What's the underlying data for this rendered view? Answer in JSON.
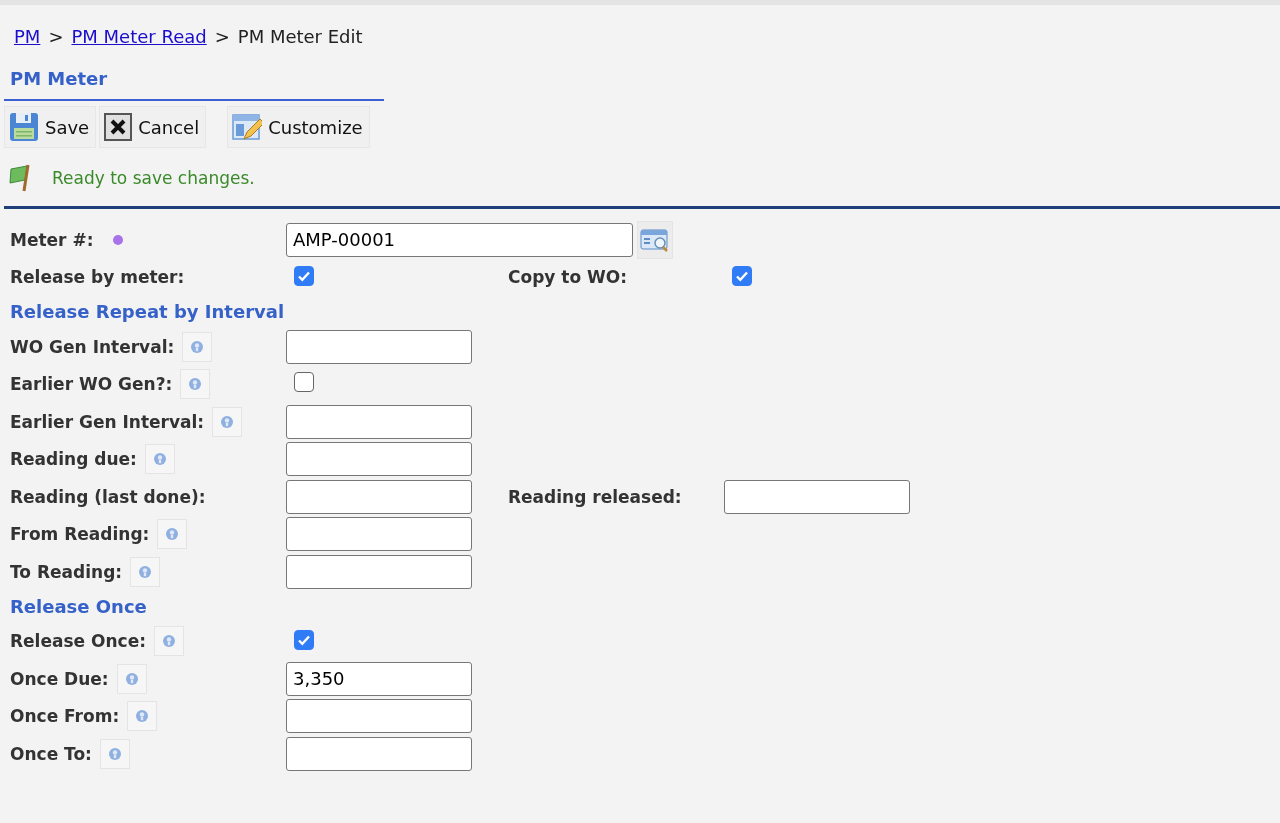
{
  "breadcrumb": [
    {
      "label": "PM",
      "link": true
    },
    {
      "label": "PM Meter Read",
      "link": true
    },
    {
      "label": "PM Meter Edit",
      "link": false
    }
  ],
  "breadcrumb_separator": ">",
  "title": "PM Meter",
  "toolbar": [
    {
      "label": "Save"
    },
    {
      "label": "Cancel"
    },
    {
      "label": "Customize"
    }
  ],
  "status_message": "Ready to save changes.",
  "form": [
    {
      "kind": "field",
      "label": "Meter #:",
      "required": true,
      "help": false,
      "control": {
        "kind": "text",
        "value": "AMP-00001",
        "wide": true,
        "lookup": true
      }
    },
    {
      "kind": "field",
      "label": "Release by meter:",
      "required": false,
      "help": false,
      "control": {
        "kind": "checkbox",
        "checked": true
      },
      "right": {
        "label": "Copy to WO:",
        "control": {
          "kind": "checkbox",
          "checked": true
        }
      }
    },
    {
      "kind": "section",
      "label": "Release Repeat by Interval"
    },
    {
      "kind": "field",
      "label": "WO Gen Interval:",
      "required": false,
      "help": true,
      "control": {
        "kind": "text"
      }
    },
    {
      "kind": "field",
      "label": "Earlier WO Gen?:",
      "required": false,
      "help": true,
      "control": {
        "kind": "checkbox",
        "checked": false
      }
    },
    {
      "kind": "field",
      "label": "Earlier Gen Interval:",
      "required": false,
      "help": true,
      "control": {
        "kind": "text"
      }
    },
    {
      "kind": "field",
      "label": "Reading due:",
      "required": false,
      "help": true,
      "control": {
        "kind": "text"
      }
    },
    {
      "kind": "field",
      "label": "Reading (last done):",
      "required": false,
      "help": false,
      "control": {
        "kind": "text"
      },
      "right": {
        "label": "Reading released:",
        "control": {
          "kind": "text"
        }
      }
    },
    {
      "kind": "field",
      "label": "From Reading:",
      "required": false,
      "help": true,
      "control": {
        "kind": "text"
      }
    },
    {
      "kind": "field",
      "label": "To Reading:",
      "required": false,
      "help": true,
      "control": {
        "kind": "text"
      }
    },
    {
      "kind": "section",
      "label": "Release Once"
    },
    {
      "kind": "field",
      "label": "Release Once:",
      "required": false,
      "help": true,
      "control": {
        "kind": "checkbox",
        "checked": true
      }
    },
    {
      "kind": "field",
      "label": "Once Due:",
      "required": false,
      "help": true,
      "control": {
        "kind": "text",
        "value": "3,350"
      }
    },
    {
      "kind": "field",
      "label": "Once From:",
      "required": false,
      "help": true,
      "control": {
        "kind": "text"
      }
    },
    {
      "kind": "field",
      "label": "Once To:",
      "required": false,
      "help": true,
      "control": {
        "kind": "text"
      }
    }
  ]
}
